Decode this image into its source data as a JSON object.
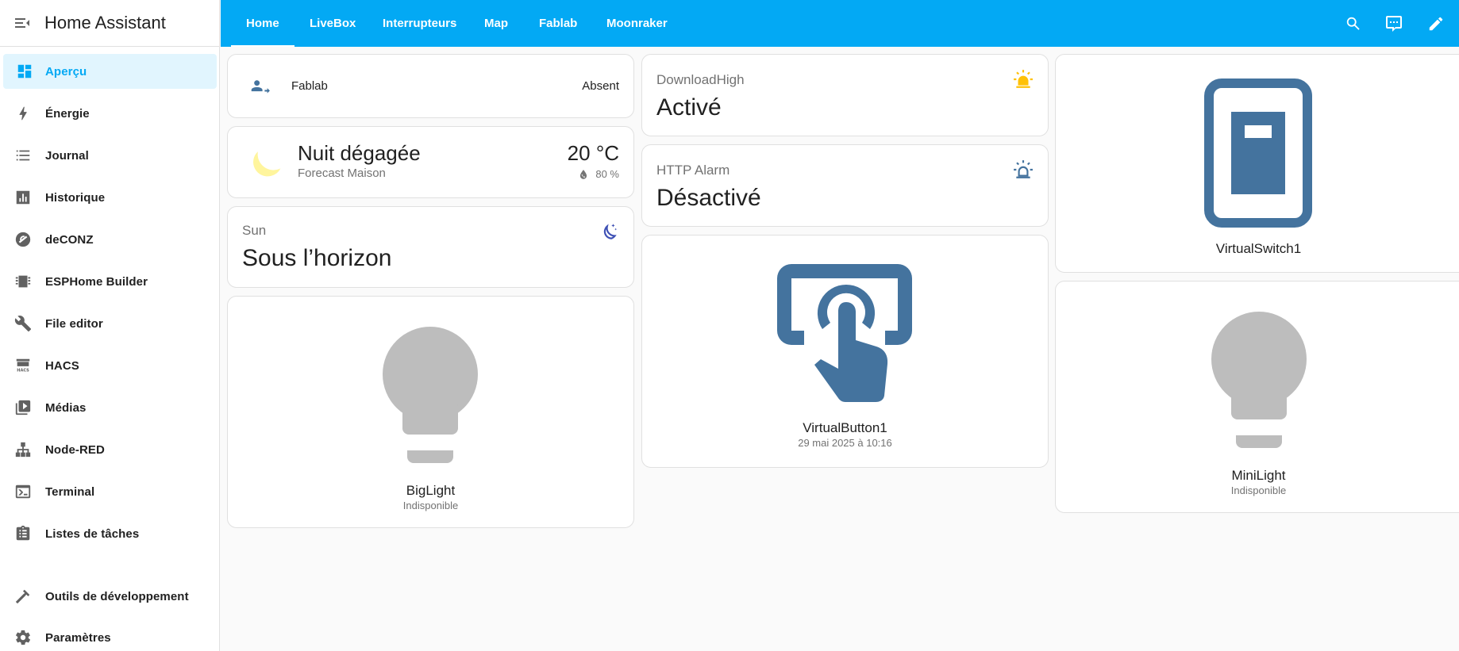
{
  "app": {
    "title": "Home Assistant"
  },
  "sidebar": {
    "items": [
      {
        "label": "Aperçu",
        "icon": "dashboard-icon"
      },
      {
        "label": "Énergie",
        "icon": "lightning-bolt-icon"
      },
      {
        "label": "Journal",
        "icon": "list-icon"
      },
      {
        "label": "Historique",
        "icon": "chart-bar-icon"
      },
      {
        "label": "deCONZ",
        "icon": "deconz-icon"
      },
      {
        "label": "ESPHome Builder",
        "icon": "chip-icon"
      },
      {
        "label": "File editor",
        "icon": "wrench-icon"
      },
      {
        "label": "HACS",
        "icon": "hacs-store-icon"
      },
      {
        "label": "Médias",
        "icon": "media-play-icon"
      },
      {
        "label": "Node-RED",
        "icon": "sitemap-icon"
      },
      {
        "label": "Terminal",
        "icon": "terminal-icon"
      },
      {
        "label": "Listes de tâches",
        "icon": "clipboard-list-icon"
      },
      {
        "label": "Outils de développement",
        "icon": "hammer-icon"
      },
      {
        "label": "Paramètres",
        "icon": "gear-icon"
      }
    ]
  },
  "tabs": [
    "Home",
    "LiveBox",
    "Interrupteurs",
    "Map",
    "Fablab",
    "Moonraker"
  ],
  "colors": {
    "primary": "#03a9f4",
    "entity_blue": "#44739e",
    "bulb_off": "#bdbdbd",
    "sun_yellow": "#ffc107"
  },
  "cards": {
    "person": {
      "name": "Fablab",
      "state": "Absent"
    },
    "weather": {
      "condition": "Nuit dégagée",
      "source": "Forecast Maison",
      "temperature": "20 °C",
      "humidity": "80 %"
    },
    "sun": {
      "label": "Sun",
      "state": "Sous l’horizon"
    },
    "biglight": {
      "name": "BigLight",
      "state": "Indisponible"
    },
    "download_high": {
      "label": "DownloadHigh",
      "state": "Activé"
    },
    "http_alarm": {
      "label": "HTTP Alarm",
      "state": "Désactivé"
    },
    "virtual_button": {
      "name": "VirtualButton1",
      "state": "29 mai 2025 à 10:16"
    },
    "virtual_switch": {
      "name": "VirtualSwitch1"
    },
    "minilight": {
      "name": "MiniLight",
      "state": "Indisponible"
    }
  }
}
